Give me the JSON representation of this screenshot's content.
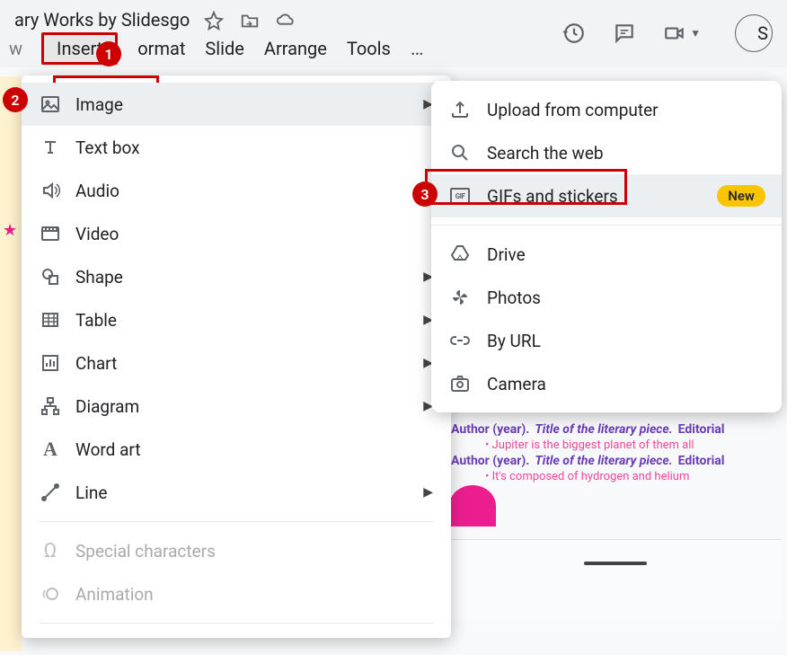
{
  "header": {
    "title_fragment": "ary Works by Slidesgo",
    "share_initial": "S"
  },
  "menubar": {
    "truncated_first": "w",
    "insert": "Insert",
    "format_fragment": "ormat",
    "slide": "Slide",
    "arrange": "Arrange",
    "tools": "Tools",
    "more": "…"
  },
  "callouts": {
    "c1": "1",
    "c2": "2",
    "c3": "3"
  },
  "dropdown": {
    "image": "Image",
    "textbox": "Text box",
    "audio": "Audio",
    "video": "Video",
    "shape": "Shape",
    "table": "Table",
    "chart": "Chart",
    "diagram": "Diagram",
    "wordart": "Word art",
    "line": "Line",
    "special": "Special characters",
    "animation": "Animation"
  },
  "submenu": {
    "upload": "Upload from computer",
    "search": "Search the web",
    "gifs": "GIFs and stickers",
    "gifs_badge": "New",
    "drive": "Drive",
    "photos": "Photos",
    "byurl": "By URL",
    "camera": "Camera",
    "gif_icon_text": "GIF"
  },
  "slide_refs": {
    "author_year": "Author (year).",
    "title": "Title of the literary piece.",
    "editorial": "Editorial",
    "sub1": "Jupiter is the biggest planet of them all",
    "sub2": "It's composed of hydrogen and helium"
  }
}
